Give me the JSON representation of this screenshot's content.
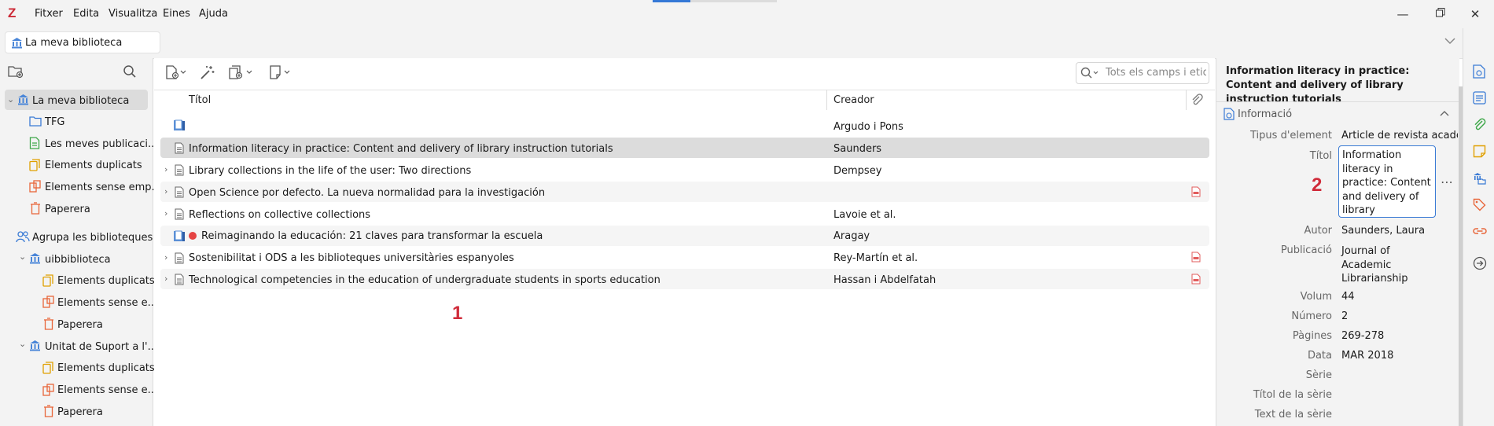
{
  "menubar": {
    "items": [
      "Fitxer",
      "Edita",
      "Visualitza",
      "Eines",
      "Ajuda"
    ],
    "logo": "Z"
  },
  "tab": {
    "label": "La meva biblioteca"
  },
  "collections": {
    "items": [
      {
        "label": "La meva biblioteca",
        "icon": "library-icon"
      },
      {
        "label": "TFG",
        "icon": "folder-icon"
      },
      {
        "label": "Les meves publicaci...",
        "icon": "publications-icon"
      },
      {
        "label": "Elements duplicats",
        "icon": "duplicates-icon"
      },
      {
        "label": "Elements sense emp...",
        "icon": "unfiled-icon"
      },
      {
        "label": "Paperera",
        "icon": "trash-icon"
      },
      {
        "label": "Agrupa les biblioteques",
        "icon": "group-icon"
      },
      {
        "label": "uibbiblioteca",
        "icon": "library-icon"
      },
      {
        "label": "Elements duplicats",
        "icon": "duplicates-icon"
      },
      {
        "label": "Elements sense e...",
        "icon": "unfiled-icon"
      },
      {
        "label": "Paperera",
        "icon": "trash-icon"
      },
      {
        "label": "Unitat de Suport a l'...",
        "icon": "library-icon"
      },
      {
        "label": "Elements duplicats",
        "icon": "duplicates-icon"
      },
      {
        "label": "Elements sense e...",
        "icon": "unfiled-icon"
      },
      {
        "label": "Paperera",
        "icon": "trash-icon"
      }
    ]
  },
  "search": {
    "placeholder": "Tots els camps i etiqu"
  },
  "columns": {
    "title": "Títol",
    "creator": "Creador"
  },
  "items": [
    {
      "title": "",
      "creator": "Argudo i Pons",
      "icon": "book-icon",
      "expandable": false,
      "pdf": false
    },
    {
      "title": "Information literacy in practice: Content and delivery of library instruction tutorials",
      "creator": "Saunders",
      "icon": "article-icon",
      "expandable": false,
      "pdf": false
    },
    {
      "title": "Library collections in the life of the user: Two directions",
      "creator": "Dempsey",
      "icon": "article-icon",
      "expandable": true,
      "pdf": false
    },
    {
      "title": "Open Science por defecto. La nueva normalidad para la investigación",
      "creator": "",
      "icon": "article-icon",
      "expandable": true,
      "pdf": true
    },
    {
      "title": "Reflections on collective collections",
      "creator": "Lavoie et al.",
      "icon": "article-icon",
      "expandable": true,
      "pdf": false
    },
    {
      "title": "Reimaginando la educación: 21 claves para transformar la escuela",
      "creator": "Aragay",
      "icon": "book-icon",
      "expandable": false,
      "pdf": false
    },
    {
      "title": "Sostenibilitat i ODS a les biblioteques universitàries espanyoles",
      "creator": "Rey-Martín et al.",
      "icon": "article-icon",
      "expandable": true,
      "pdf": true
    },
    {
      "title": "Technological competencies in the education of undergraduate students in sports education",
      "creator": "Hassan i Abdelfatah",
      "icon": "article-icon",
      "expandable": true,
      "pdf": true
    }
  ],
  "annotations": {
    "one": "1",
    "two": "2"
  },
  "info": {
    "header_title": "Information literacy in practice: Content and delivery of library instruction tutorials",
    "section": "Informació",
    "fields": [
      {
        "label": "Tipus d'element",
        "value": "Article de revista acadèmi"
      },
      {
        "label": "Títol",
        "value": "Information literacy in practice: Content and delivery of library instruction tutorials"
      },
      {
        "label": "Autor",
        "value": "Saunders, Laura"
      },
      {
        "label": "Publicació",
        "value": "Journal of Academic Librarianship"
      },
      {
        "label": "Volum",
        "value": "44"
      },
      {
        "label": "Número",
        "value": "2"
      },
      {
        "label": "Pàgines",
        "value": "269-278"
      },
      {
        "label": "Data",
        "value": "MAR 2018"
      },
      {
        "label": "Sèrie",
        "value": ""
      },
      {
        "label": "Títol de la sèrie",
        "value": ""
      },
      {
        "label": "Text de la sèrie",
        "value": ""
      }
    ]
  },
  "colors": {
    "accent": "#3a7bd5",
    "annotation": "#d02b3a",
    "logo": "#cc2936",
    "unread_dot": "#e54444"
  }
}
